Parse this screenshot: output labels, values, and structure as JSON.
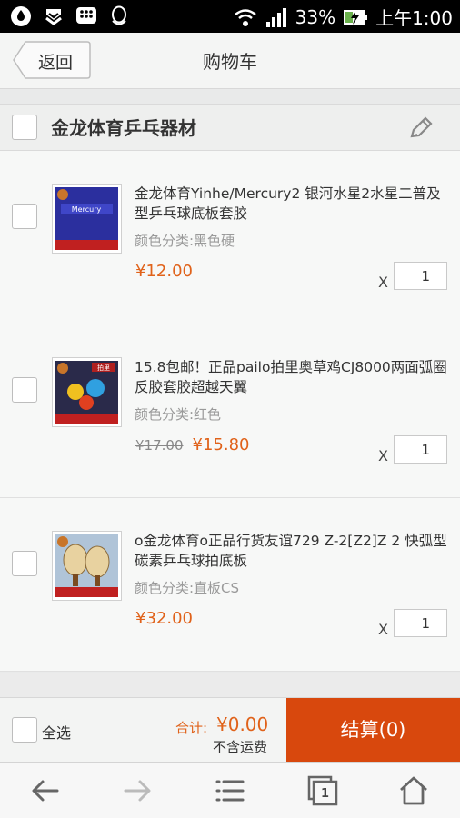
{
  "status_bar": {
    "battery": "33%",
    "time": "上午1:00"
  },
  "header": {
    "back_label": "返回",
    "title": "购物车"
  },
  "shop": {
    "name": "金龙体育乒乓器材"
  },
  "items": [
    {
      "title": "金龙体育Yinhe/Mercury2 银河水星2水星二普及型乒乓球底板套胶",
      "variant": "颜色分类:黑色硬",
      "old_price": "",
      "price": "¥12.00",
      "qty_prefix": "X",
      "quantity": "1",
      "thumb_text": "Mercury"
    },
    {
      "title": "15.8包邮！正品pailo拍里奥草鸡CJ8000两面弧圈反胶套胶超越天翼",
      "variant": "颜色分类:红色",
      "old_price": "¥17.00",
      "price": "¥15.80",
      "qty_prefix": "X",
      "quantity": "1",
      "thumb_text": "拍里"
    },
    {
      "title": "o金龙体育o正品行货友谊729 Z-2[Z2]Z 2 快弧型碳素乒乓球拍底板",
      "variant": "颜色分类:直板CS",
      "old_price": "",
      "price": "¥32.00",
      "qty_prefix": "X",
      "quantity": "1",
      "thumb_text": ""
    }
  ],
  "checkout": {
    "select_all": "全选",
    "total_label": "合计:",
    "total_value": "¥0.00",
    "shipping_note": "不含运费",
    "checkout_button": "结算(0)"
  },
  "nav": {
    "tabs_count": "1"
  },
  "colors": {
    "accent": "#d8480d",
    "price": "#e0621a"
  }
}
